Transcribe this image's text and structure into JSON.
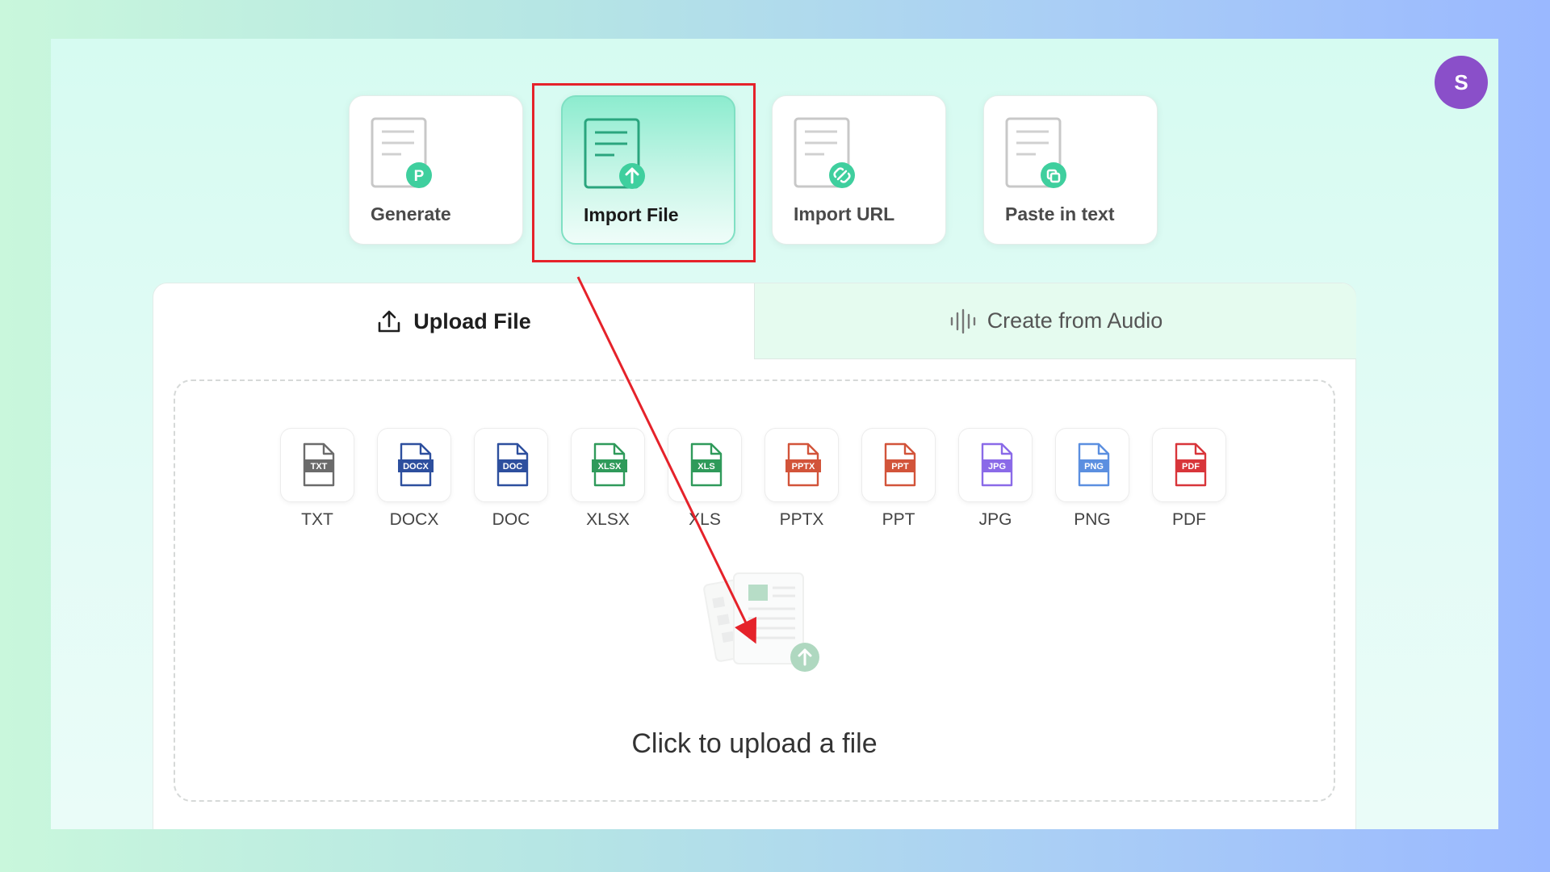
{
  "avatar": {
    "initial": "S"
  },
  "modes": [
    {
      "label": "Generate",
      "badge": "P"
    },
    {
      "label": "Import File",
      "badge": "upload"
    },
    {
      "label": "Import URL",
      "badge": "link"
    },
    {
      "label": "Paste in text",
      "badge": "copy"
    }
  ],
  "tabs": {
    "upload": "Upload File",
    "audio": "Create from Audio"
  },
  "formats": [
    {
      "tag": "TXT",
      "label": "TXT",
      "color": "#6b6b6b"
    },
    {
      "tag": "DOCX",
      "label": "DOCX",
      "color": "#2d4f9e"
    },
    {
      "tag": "DOC",
      "label": "DOC",
      "color": "#2d4f9e"
    },
    {
      "tag": "XLSX",
      "label": "XLSX",
      "color": "#2f9a5a"
    },
    {
      "tag": "XLS",
      "label": "XLS",
      "color": "#2f9a5a"
    },
    {
      "tag": "PPTX",
      "label": "PPTX",
      "color": "#d2543a"
    },
    {
      "tag": "PPT",
      "label": "PPT",
      "color": "#d2543a"
    },
    {
      "tag": "JPG",
      "label": "JPG",
      "color": "#8a6ae8"
    },
    {
      "tag": "PNG",
      "label": "PNG",
      "color": "#5b8fe0"
    },
    {
      "tag": "PDF",
      "label": "PDF",
      "color": "#d8353a"
    }
  ],
  "dropzone": {
    "cta": "Click to upload a file"
  },
  "colors": {
    "accent": "#3fcf9e",
    "highlight": "#e5222a",
    "avatar": "#8a4fc9"
  }
}
